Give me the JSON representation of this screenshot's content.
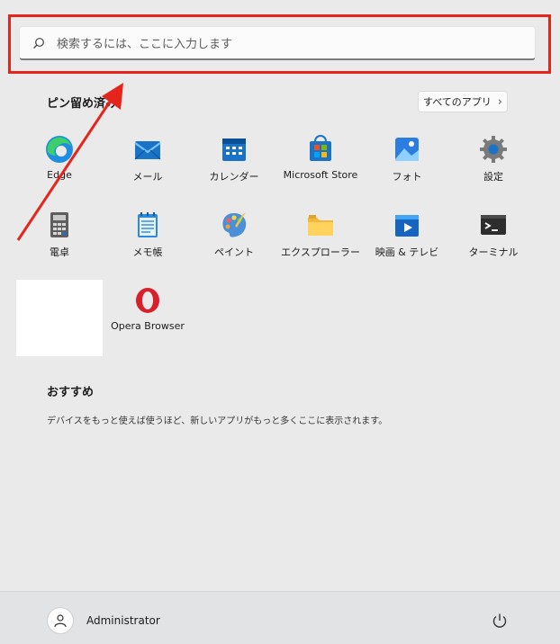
{
  "search": {
    "placeholder": "検索するには、ここに入力します"
  },
  "pinned": {
    "title": "ピン留め済み",
    "all_apps_label": "すべてのアプリ",
    "apps": [
      {
        "label": "Edge",
        "icon": "edge-icon"
      },
      {
        "label": "メール",
        "icon": "mail-icon"
      },
      {
        "label": "カレンダー",
        "icon": "calendar-icon"
      },
      {
        "label": "Microsoft Store",
        "icon": "store-icon"
      },
      {
        "label": "フォト",
        "icon": "photos-icon"
      },
      {
        "label": "設定",
        "icon": "settings-icon"
      },
      {
        "label": "電卓",
        "icon": "calculator-icon"
      },
      {
        "label": "メモ帳",
        "icon": "notepad-icon"
      },
      {
        "label": "ペイント",
        "icon": "paint-icon"
      },
      {
        "label": "エクスプローラー",
        "icon": "explorer-icon"
      },
      {
        "label": "映画 & テレビ",
        "icon": "movies-icon"
      },
      {
        "label": "ターミナル",
        "icon": "terminal-icon"
      },
      {
        "label": "Opera Browser",
        "icon": "opera-icon"
      }
    ]
  },
  "recommended": {
    "title": "おすすめ",
    "message": "デバイスをもっと使えば使うほど、新しいアプリがもっと多くここに表示されます。"
  },
  "user": {
    "name": "Administrator"
  },
  "colors": {
    "highlight": "#e5251c",
    "accent": "#0067c0"
  }
}
